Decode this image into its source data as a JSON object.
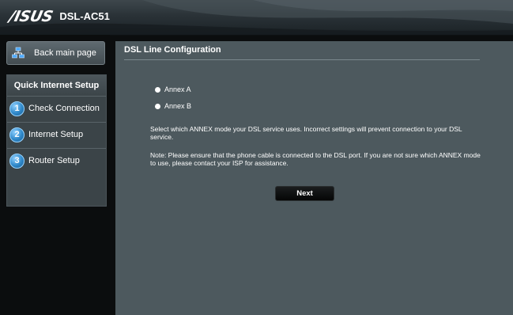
{
  "header": {
    "brand": "/ISUS",
    "model": "DSL-AC51"
  },
  "sidebar": {
    "back_label": "Back main page",
    "qis_title": "Quick Internet Setup",
    "steps": [
      {
        "number": "1",
        "label": "Check Connection"
      },
      {
        "number": "2",
        "label": "Internet Setup"
      },
      {
        "number": "3",
        "label": "Router Setup"
      }
    ]
  },
  "main": {
    "title": "DSL Line Configuration",
    "options": [
      {
        "label": "Annex A"
      },
      {
        "label": "Annex B"
      }
    ],
    "description": "Select which ANNEX mode your DSL service uses. Incorrect settings will prevent connection to your DSL service.",
    "note": "Note: Please ensure that the phone cable is connected to the DSL port. If you are not sure which ANNEX mode to use, please contact your ISP for assistance.",
    "next_label": "Next"
  },
  "colors": {
    "accent_blue": "#2f88c9",
    "panel": "#4d595e",
    "sidebar_panel": "#3b4448"
  }
}
